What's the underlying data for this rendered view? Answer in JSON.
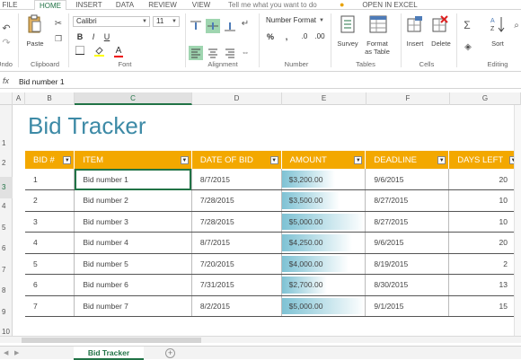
{
  "ribbon_tabs": [
    "FILE",
    "HOME",
    "INSERT",
    "DATA",
    "REVIEW",
    "VIEW"
  ],
  "tell_me_placeholder": "Tell me what you want to do",
  "open_in_excel": "OPEN IN EXCEL",
  "ribbon": {
    "undo_label": "Undo",
    "paste_label": "Paste",
    "clipboard_label": "Clipboard",
    "font_name": "Calibri",
    "font_size": "11",
    "font_label": "Font",
    "alignment_label": "Alignment",
    "number_format": "Number Format",
    "number_label": "Number",
    "survey_label": "Survey",
    "format_label_1": "Format",
    "format_label_2": "as Table",
    "tables_label": "Tables",
    "insert_label": "Insert",
    "delete_label": "Delete",
    "cells_label": "Cells",
    "sort_label": "Sort",
    "editing_label": "Editing",
    "bold": "B",
    "italic": "I",
    "underline": "U",
    "percent": "%",
    "comma": ",",
    "sigma": "Σ"
  },
  "formula_bar": {
    "fx": "fx",
    "content": "Bid number 1"
  },
  "columns": [
    "A",
    "B",
    "C",
    "D",
    "E",
    "F",
    "G"
  ],
  "rows": [
    "1",
    "2",
    "3",
    "4",
    "5",
    "6",
    "7",
    "8",
    "9",
    "10"
  ],
  "sheet": {
    "title": "Bid Tracker",
    "headers": [
      "BID #",
      "ITEM",
      "DATE OF BID",
      "AMOUNT",
      "DEADLINE",
      "DAYS LEFT"
    ],
    "bids": [
      {
        "id": "1",
        "item": "Bid number 1",
        "date": "8/7/2015",
        "amount": "$3,200.00",
        "amount_value": 3200,
        "deadline": "9/6/2015",
        "days_left": "20"
      },
      {
        "id": "2",
        "item": "Bid number 2",
        "date": "7/28/2015",
        "amount": "$3,500.00",
        "amount_value": 3500,
        "deadline": "8/27/2015",
        "days_left": "10"
      },
      {
        "id": "3",
        "item": "Bid number 3",
        "date": "7/28/2015",
        "amount": "$5,000.00",
        "amount_value": 5000,
        "deadline": "8/27/2015",
        "days_left": "10"
      },
      {
        "id": "4",
        "item": "Bid number 4",
        "date": "8/7/2015",
        "amount": "$4,250.00",
        "amount_value": 4250,
        "deadline": "9/6/2015",
        "days_left": "20"
      },
      {
        "id": "5",
        "item": "Bid number 5",
        "date": "7/20/2015",
        "amount": "$4,000.00",
        "amount_value": 4000,
        "deadline": "8/19/2015",
        "days_left": "2"
      },
      {
        "id": "6",
        "item": "Bid number 6",
        "date": "7/31/2015",
        "amount": "$2,700.00",
        "amount_value": 2700,
        "deadline": "8/30/2015",
        "days_left": "13"
      },
      {
        "id": "7",
        "item": "Bid number 7",
        "date": "8/2/2015",
        "amount": "$5,000.00",
        "amount_value": 5000,
        "deadline": "9/1/2015",
        "days_left": "15"
      }
    ]
  },
  "sheet_tab": "Bid Tracker",
  "add_sheet": "+",
  "colors": {
    "accent": "#217346",
    "header_fill": "#f3a800",
    "title": "#3d8aa6",
    "databar": "#7ec2d4"
  }
}
